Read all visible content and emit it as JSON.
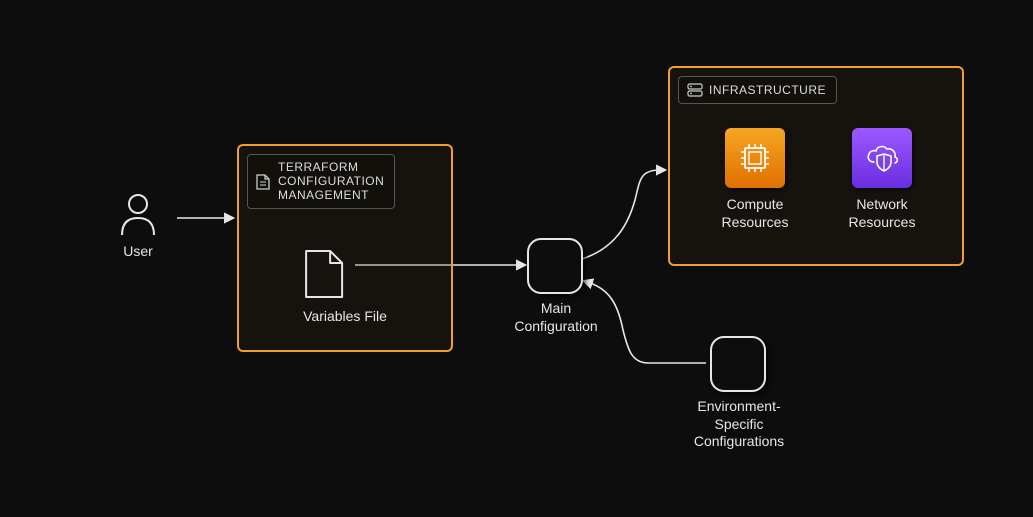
{
  "user": {
    "label": "User"
  },
  "terraform_group": {
    "title": "TERRAFORM\nCONFIGURATION\nMANAGEMENT",
    "variables_label": "Variables File"
  },
  "main_config": {
    "label": "Main\nConfiguration"
  },
  "env_specific": {
    "label": "Environment-\nSpecific\nConfigurations"
  },
  "infrastructure_group": {
    "title": "INFRASTRUCTURE",
    "compute_label": "Compute\nResources",
    "network_label": "Network\nResources"
  }
}
